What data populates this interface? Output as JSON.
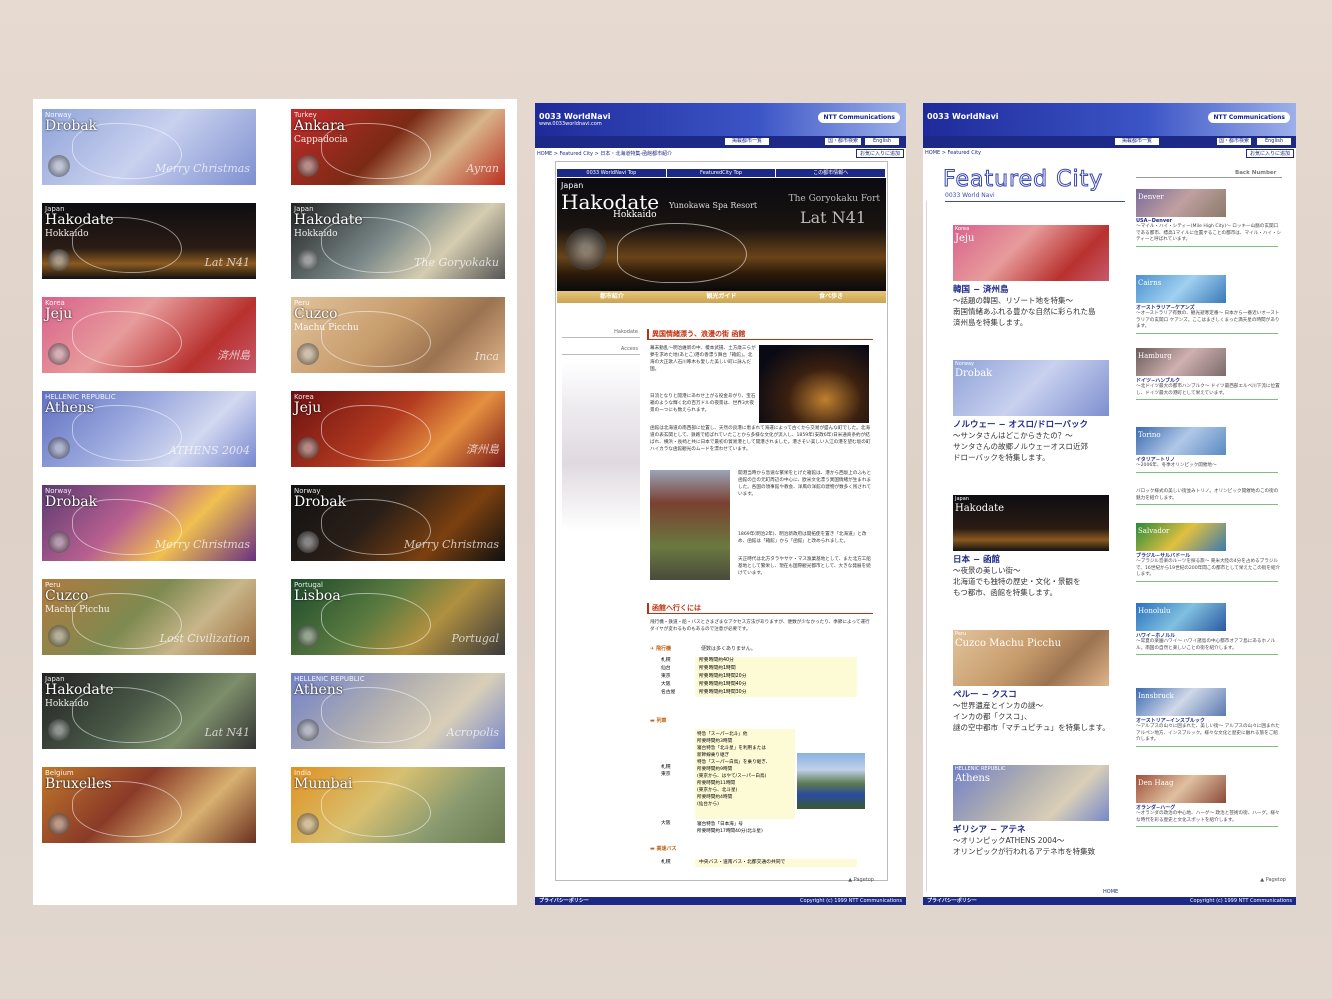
{
  "panel1": {
    "banners": [
      {
        "country": "Norway",
        "name": "Drobak",
        "sub": "",
        "deco": "Merry Christmas",
        "bg": "linear-gradient(135deg,#8fa3d8,#c9d1ef 50%,#7d8fcf)"
      },
      {
        "country": "Turkey",
        "name": "Ankara",
        "sub": "Cappadocia",
        "deco": "Ayran",
        "bg": "linear-gradient(135deg,#c22b2b,#7a2a15 45%,#d8b48a 70%,#b93020)"
      },
      {
        "country": "Japan",
        "name": "Hakodate",
        "sub": "Hokkaido",
        "deco": "Lat N41",
        "bg": "linear-gradient(180deg,#0d0d12,#2b1c14 60%,#8a5a20 80%,#111)"
      },
      {
        "country": "Japan",
        "name": "Hakodate",
        "sub": "Hokkaido",
        "deco": "The Goryokaku",
        "bg": "linear-gradient(135deg,#222,#7c8a8a 45%,#d6cdb0 70%,#555)"
      },
      {
        "country": "Korea",
        "name": "Jeju",
        "sub": "",
        "deco": "済州島",
        "bg": "linear-gradient(135deg,#d9618c,#e79b9b 40%,#b8312e 75%,#c75a6c)"
      },
      {
        "country": "Peru",
        "name": "Cuzco",
        "sub": "Machu Picchu",
        "deco": "Inca",
        "bg": "linear-gradient(135deg,#e2c39c,#c69b6b 45%,#9b7350 70%,#e0b58b)"
      },
      {
        "country": "HELLENIC REPUBLIC",
        "name": "Athens",
        "sub": "",
        "deco": "ATHENS 2004",
        "bg": "linear-gradient(135deg,#6070c0,#9aa8de 40%,#d2d8f0 70%,#7686cf)"
      },
      {
        "country": "Korea",
        "name": "Jeju",
        "sub": "",
        "deco": "済州島",
        "bg": "linear-gradient(135deg,#6a1010,#b23a20 45%,#e49040 70%,#7a1818)"
      },
      {
        "country": "Norway",
        "name": "Drobak",
        "sub": "",
        "deco": "Merry Christmas",
        "bg": "linear-gradient(135deg,#5a3a70,#b86090 40%,#f0c050 65%,#6a3080)"
      },
      {
        "country": "Norway",
        "name": "Drobak",
        "sub": "",
        "deco": "Merry Christmas",
        "bg": "linear-gradient(135deg,#111,#2a1f18 40%,#7c4010 70%,#101010)"
      },
      {
        "country": "Peru",
        "name": "Cuzco",
        "sub": "Machu Picchu",
        "deco": "Lost Civilization",
        "bg": "linear-gradient(135deg,#b07a40,#7e8a50 45%,#c8b68a 70%,#9a6a3a)"
      },
      {
        "country": "Portugal",
        "name": "Lisboa",
        "sub": "",
        "deco": "Portugal",
        "bg": "linear-gradient(135deg,#1c4a2a,#5a7a40 40%,#b09040 65%,#3a3a3a)"
      },
      {
        "country": "Japan",
        "name": "Hakodate",
        "sub": "Hokkaido",
        "deco": "Lat N41",
        "bg": "linear-gradient(135deg,#222,#4a5a48 45%,#7d8e6a 70%,#333)"
      },
      {
        "country": "HELLENIC REPUBLIC",
        "name": "Athens",
        "sub": "",
        "deco": "Acropolis",
        "bg": "linear-gradient(135deg,#7080c8,#b5b2b0 45%,#d9cfb8 70%,#7888c8)"
      },
      {
        "country": "Belgium",
        "name": "Bruxelles",
        "sub": "",
        "deco": "",
        "bg": "linear-gradient(135deg,#c0782a,#8a3a28 40%,#d8b070 70%,#6a3020)"
      },
      {
        "country": "India",
        "name": "Mumbai",
        "sub": "",
        "deco": "",
        "bg": "linear-gradient(135deg,#e09020,#d8c070 40%,#8a9a70 70%,#6a7a50)"
      }
    ]
  },
  "panel2": {
    "brand": "0033 WorldNavi",
    "brand_url": "www.0033worldnavi.com",
    "ntt": "NTT Communications",
    "btn_list": "掲載都市一覧",
    "btn_search": "国・都市検索",
    "btn_english": "English",
    "breadcrumb": "HOME > Featured City > 日本・北海道特集-函館都市紹介",
    "fav": "お気に入りに追加",
    "nav": [
      "0033 WorldNavi Top",
      "FeaturedCity Top",
      "この都市情報へ"
    ],
    "hero": {
      "country": "Japan",
      "name": "Hakodate",
      "sub": "Hokkaido",
      "r1": "Yunokawa Spa Resort",
      "r2": "The Goryokaku Fort",
      "r3": "Lat N41"
    },
    "tabs": [
      "都市紹介",
      "観光ガイド",
      "食べ歩き"
    ],
    "side": [
      "Hakodate",
      "Access"
    ],
    "title1": "異国情緒漂う、浪漫の街 函館",
    "p1": "幕末動乱～明治維新の中、榎本武揚、土方歳三らが夢を求めた地(あとこ)港の香漂う舞台「箱館」。北海の大正歌人石川啄木も愛した美しい町に詠んだ国。",
    "p2": "日流となりと開港にあわせ上がる役金あがり、宝石箱のような輝く北の百万ドルの夜景は、世界3大夜景の一つにも数えられます。",
    "p3": "函館は北海道の南西部に位置し、天然の良港に恵まれて海運によって古くから交易が盛んな町でした。北海道の表玄関として、鉄路で結ばれていたことから多様な文化が流入し、1859年(安政6年)日米通商条約が結ばれ、横浜・長崎と共に日本で最初の貿易港として開港されました。港さそい美しい入江の港を望む坂の町ハイカラな函館観光のムードを漂わせています。",
    "p4": "開港当時から急速な繁栄をとげた箱館は、港から西坂上のふもと函館の丘の元町周辺の中心に、欧米文化漂う異国情緒が生まれました。各国の領事館や教会、洋風の洋館の建物が数多く残されています。",
    "p5": "1869年(明治2年)、明治新政府は開拓使を置き「北海道」と改め、函館は「箱館」から「函館」と改められました。",
    "p6": "天正時代は北方タラやサケ・マス漁業基地として、また北方工船基地として繁栄し、現在も国際観光都市として、大きな発展を続けています。",
    "title2": "函館へ行くには",
    "p7": "飛行機・鉄道・船・バスとさまざまなアクセス方法がありますが、便数が少なかったり、季節によって運行ダイヤが変わるものもあるので注意が必要です。",
    "air_head": "飛行機",
    "air_note": "便数は多くありません。",
    "air_rows": [
      [
        "札幌",
        "所要時間約40分"
      ],
      [
        "仙台",
        "所要時間約1時間"
      ],
      [
        "東京",
        "所要時間約1時間20分"
      ],
      [
        "大阪",
        "所要時間約1時間40分"
      ],
      [
        "名古屋",
        "所要時間約1時間30分"
      ]
    ],
    "train_head": "列車",
    "train_city": "札幌\n東京",
    "train_desc": "特急「スーパー北斗」他\n所要時間約3時間\n寝台特急「北斗星」を利用または\n新幹線乗り継ぎ\n特急「スーパー白鳥」を乗り継ぎ、\n所要時間約9時間\n(東京から、はやて/スーパー白鳥)\n所要時間約11時間\n(東京から、北斗星)\n所要時間約4時間\n(仙台から)",
    "osaka": "大阪",
    "osaka_desc": "寝台特急「日本海」号\n所要時間約17時間40分(北斗星)",
    "bus_head": "高速バス",
    "bus_row": [
      "札幌",
      "中央バス・道南バス・北都交通の共同で"
    ],
    "pagetop": "Pagetop",
    "footer_left": "プライバシーポリシー",
    "footer_right": "Copyright (c) 1999 NTT Communications"
  },
  "panel3": {
    "brand": "0033 WorldNavi",
    "ntt": "NTT Communications",
    "btn_list": "掲載都市一覧",
    "btn_search": "国・都市検索",
    "btn_english": "English",
    "breadcrumb": "HOME > Featured City",
    "fav": "お気に入りに追加",
    "title": "Featured City",
    "subtitle": "0033 World Navi",
    "back": "Back Number",
    "cities": [
      {
        "thumb": "Jeju",
        "country": "Korea",
        "t": "韓国 − 済州島",
        "d": "〜話題の韓国、リゾート地を特集〜\n南国情緒あふれる豊かな自然に彩られた島\n済州島を特集します。",
        "bg": "linear-gradient(135deg,#d9618c,#e79b9b 40%,#b8312e 75%,#c75a6c)"
      },
      {
        "thumb": "Drobak",
        "country": "Norway",
        "t": "ノルウェー − オスロ/ドローバック",
        "d": "〜サンタさんはどこからきたの？〜\nサンタさんの故郷ノルウェーオスロ近郊\nドローバックを特集します。",
        "bg": "linear-gradient(135deg,#8fa3d8,#c9d1ef 50%,#7d8fcf)"
      },
      {
        "thumb": "Hakodate",
        "country": "Japan",
        "t": "日本 − 函館",
        "d": "〜夜景の美しい街〜\n北海道でも独特の歴史・文化・景観を\nもつ都市、函館を特集します。",
        "bg": "linear-gradient(180deg,#0d0d12,#2b1c14 60%,#8a5a20 80%,#111)"
      },
      {
        "thumb": "Cuzco Machu Picchu",
        "country": "Peru",
        "t": "ペルー − クスコ",
        "d": "〜世界遺産とインカの謎〜\nインカの都「クスコ」、\n謎の空中都市「マチュピチュ」を特集します。",
        "bg": "linear-gradient(135deg,#e2c39c,#c69b6b 45%,#9b7350 70%,#e0b58b)"
      },
      {
        "thumb": "Athens",
        "country": "HELLENIC REPUBLIC",
        "t": "ギリシア − アテネ",
        "d": "〜オリンピックATHENS 2004〜\nオリンピックが行われるアテネ市を特集致",
        "bg": "linear-gradient(135deg,#7080c8,#b5b2b0 45%,#d9cfb8 70%,#7888c8)"
      }
    ],
    "side": [
      {
        "img": "Denver",
        "l": "USA−Denver",
        "d": "〜マイル・ハイ・シティー(Mile High City)〜 ロッキー山脈の玄関口である都市、標高1マイルに位置することの都市は、マイル・ハイ・シティーと呼ばれています。",
        "bg": "linear-gradient(135deg,#7a6a9a,#c0a0a0 50%,#8a7a6a)"
      },
      {
        "img": "Cairns",
        "l": "オーストラリア−ケアンズ",
        "d": "〜オーストラリア有数の、観光避寒定番〜 日本から一番近いオーストラリアの玄関口 ケアンズ。ここはまさしくまった満天星の時間があります。",
        "bg": "linear-gradient(135deg,#4a90d0,#a0d0f0 50%,#3a7ab8)"
      },
      {
        "img": "Hamburg",
        "l": "ドイツ−ハンブルク",
        "d": "〜北ドイツ最大の都市ハンブルク〜 ドイツ最西部エルベ川下流に位置し、ドイツ最大の港町として栄えています。",
        "bg": "linear-gradient(135deg,#6a5a5a,#d0b0b0 50%,#7a6a6a)"
      },
      {
        "img": "Torino",
        "l": "イタリア−トリノ",
        "d": "〜2006年、冬季オリンピック開催地〜",
        "bg": "linear-gradient(135deg,#3a6ab0,#b0c8e8 50%,#5a8ac0)"
      },
      {
        "img": "",
        "l": "",
        "d": "バロック様式の美しい街並みトリノ。オリンピック開催地のこの街の魅力を紹介します。",
        "bg": ""
      },
      {
        "img": "Salvador",
        "l": "ブラジル−サルバドール",
        "d": "〜ブラジル音楽のルーツを探る旅〜 東米大陸の4分を占めるブラジルで、16世紀から19世紀の200年間この都市として栄えたこの街を紹介します。",
        "bg": "linear-gradient(135deg,#2a8a3a,#e0c040 50%,#3a7ab0)"
      },
      {
        "img": "Honolulu",
        "l": "ハワイ−ホノルル",
        "d": "〜常夏の楽園ハワイ〜 ハワイ諸島の中心都市オアフ島にあるホノルル。南国の自然と楽しいことの街を紹介します。",
        "bg": "linear-gradient(135deg,#2a70c0,#80c0e0 50%,#2a5aa0)"
      },
      {
        "img": "Innsbruck",
        "l": "オーストリア−インスブルック",
        "d": "〜アルプスの山々に囲まれた、美しい街〜 アルプスの山々に囲まれたアルペン地方、インスブルック。様々な文化と歴史に触れる旅をご紹介します。",
        "bg": "linear-gradient(135deg,#3a6ab0,#d0d8e8 50%,#5a7ab0)"
      },
      {
        "img": "Den Haag",
        "l": "オランダ−ハーグ",
        "d": "〜オランダの政治の中心地、ハーグ〜 政治と芸術の街、ハーグ。様々な時代を彩る歴史と文化スポットを紹介します。",
        "bg": "linear-gradient(135deg,#a0503a,#e0c0a0 50%,#8a4a3a)"
      }
    ],
    "pagetop": "Pagetop",
    "home": "HOME",
    "footer_left": "プライバシーポリシー",
    "footer_right": "Copyright (c) 1999 NTT Communications"
  }
}
